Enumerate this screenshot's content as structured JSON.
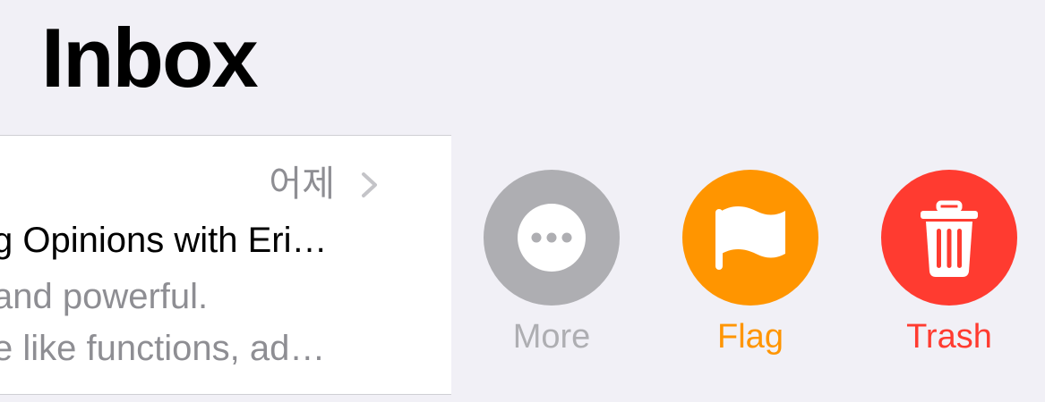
{
  "header": {
    "title": "Inbox"
  },
  "message": {
    "date": "어제",
    "subject": "g Opinions with Eri…",
    "preview_line1": "and powerful.",
    "preview_line2": "e like functions, ad…"
  },
  "actions": [
    {
      "label": "More",
      "icon": "ellipsis-icon",
      "color": "#aeaeb2"
    },
    {
      "label": "Flag",
      "icon": "flag-icon",
      "color": "#ff9500"
    },
    {
      "label": "Trash",
      "icon": "trash-icon",
      "color": "#ff3b30"
    }
  ],
  "colors": {
    "background": "#f1f0f6",
    "row_background": "#ffffff",
    "secondary_text": "#8e8e93"
  }
}
